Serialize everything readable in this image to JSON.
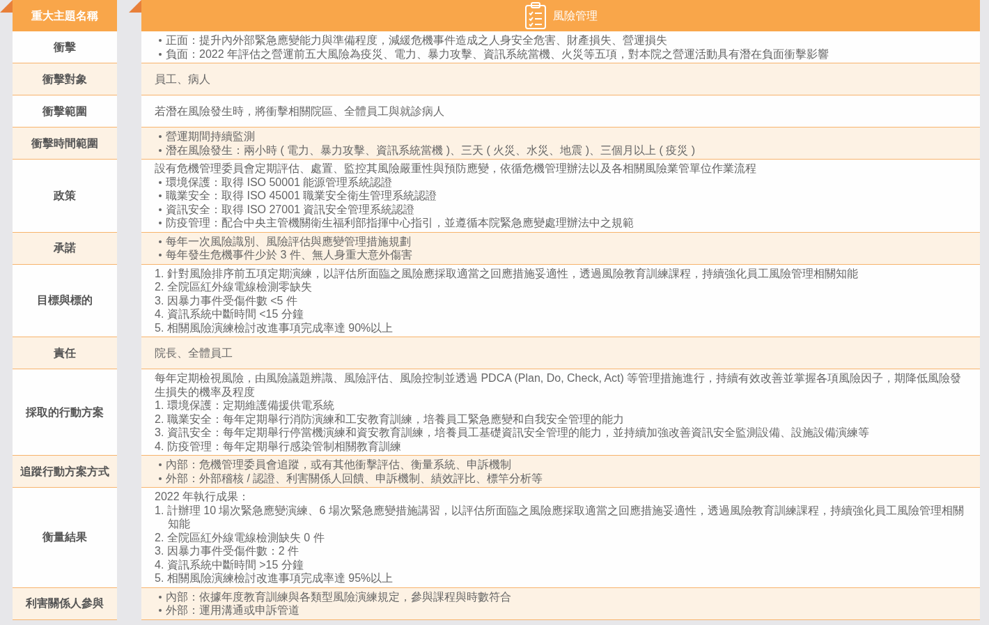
{
  "header": {
    "label_column": "重大主題名稱",
    "topic": "風險管理"
  },
  "rows": [
    {
      "label": "衝擊",
      "lines": [
        {
          "kind": "bullet",
          "text": "正面：提升內外部緊急應變能力與準備程度，減緩危機事件造成之人身安全危害、財產損失、營運損失"
        },
        {
          "kind": "bullet",
          "text": "負面：2022 年評估之營運前五大風險為疫災、電力、暴力攻擊、資訊系統當機、火災等五項，對本院之營運活動具有潛在負面衝擊影響"
        }
      ]
    },
    {
      "label": "衝擊對象",
      "lines": [
        {
          "kind": "plain",
          "text": "員工、病人"
        }
      ]
    },
    {
      "label": "衝擊範圍",
      "lines": [
        {
          "kind": "plain",
          "text": "若潛在風險發生時，將衝擊相關院區、全體員工與就診病人"
        }
      ]
    },
    {
      "label": "衝擊時間範圍",
      "lines": [
        {
          "kind": "bullet",
          "text": "營運期間持續監測"
        },
        {
          "kind": "bullet",
          "text": "潛在風險發生：兩小時 ( 電力、暴力攻擊、資訊系統當機 )、三天 ( 火災、水災、地震 )、三個月以上 ( 疫災 )"
        }
      ]
    },
    {
      "label": "政策",
      "lines": [
        {
          "kind": "plain",
          "text": "設有危機管理委員會定期評估、處置、監控其風險嚴重性與預防應變，依循危機管理辦法以及各相關風險業管單位作業流程"
        },
        {
          "kind": "bullet",
          "text": "環境保護：取得 ISO 50001 能源管理系統認證"
        },
        {
          "kind": "bullet",
          "text": "職業安全：取得 ISO 45001 職業安全衛生管理系統認證"
        },
        {
          "kind": "bullet",
          "text": "資訊安全：取得 ISO 27001 資訊安全管理系統認證"
        },
        {
          "kind": "bullet",
          "text": "防疫管理：配合中央主管機關衛生福利部指揮中心指引，並遵循本院緊急應變處理辦法中之規範"
        }
      ]
    },
    {
      "label": "承諾",
      "lines": [
        {
          "kind": "bullet",
          "text": "每年一次風險識別、風險評估與應變管理措施規劃"
        },
        {
          "kind": "bullet",
          "text": "每年發生危機事件少於 3 件、無人身重大意外傷害"
        }
      ]
    },
    {
      "label": "目標與標的",
      "lines": [
        {
          "kind": "numbered",
          "text": "1. 針對風險排序前五項定期演練，以評估所面臨之風險應採取適當之回應措施妥適性，透過風險教育訓練課程，持續強化員工風險管理相關知能"
        },
        {
          "kind": "numbered",
          "text": "2. 全院區紅外線電線檢測零缺失"
        },
        {
          "kind": "numbered",
          "text": "3. 因暴力事件受傷件數 <5 件"
        },
        {
          "kind": "numbered",
          "text": "4. 資訊系統中斷時間 <15 分鐘"
        },
        {
          "kind": "numbered",
          "text": "5. 相關風險演練檢討改進事項完成率達 90%以上"
        }
      ]
    },
    {
      "label": "責任",
      "lines": [
        {
          "kind": "plain",
          "text": "院長、全體員工"
        }
      ]
    },
    {
      "label": "採取的行動方案",
      "lines": [
        {
          "kind": "plain",
          "text": "每年定期檢視風險，由風險議題辨識、風險評估、風險控制並透過 PDCA (Plan, Do, Check, Act) 等管理措施進行，持續有效改善並掌握各項風險因子，期降低風險發生損失的機率及程度"
        },
        {
          "kind": "numbered",
          "text": "1. 環境保護：定期維護備援供電系統"
        },
        {
          "kind": "numbered",
          "text": "2. 職業安全：每年定期舉行消防演練和工安教育訓練，培養員工緊急應變和自我安全管理的能力"
        },
        {
          "kind": "numbered",
          "text": "3. 資訊安全：每年定期舉行停當機演練和資安教育訓練，培養員工基礎資訊安全管理的能力，並持續加強改善資訊安全監測設備、設施設備演練等"
        },
        {
          "kind": "numbered",
          "text": "4. 防疫管理：每年定期舉行感染管制相關教育訓練"
        }
      ]
    },
    {
      "label": "追蹤行動方案方式",
      "lines": [
        {
          "kind": "bullet",
          "text": "內部：危機管理委員會追蹤，或有其他衝擊評估、衡量系統、申訴機制"
        },
        {
          "kind": "bullet",
          "text": "外部：外部稽核 / 認證、利害關係人回饋、申訴機制、績效評比、標竿分析等"
        }
      ]
    },
    {
      "label": "衡量結果",
      "lines": [
        {
          "kind": "plain",
          "text": "2022 年執行成果："
        },
        {
          "kind": "numbered",
          "text": "1. 計辦理 10 場次緊急應變演練、6 場次緊急應變措施講習，以評估所面臨之風險應採取適當之回應措施妥適性，透過風險教育訓練課程，持續強化員工風險管理相關知能"
        },
        {
          "kind": "numbered",
          "text": "2. 全院區紅外線電線檢測缺失 0 件"
        },
        {
          "kind": "numbered",
          "text": "3. 因暴力事件受傷件數：2 件"
        },
        {
          "kind": "numbered",
          "text": "4. 資訊系統中斷時間 >15 分鐘"
        },
        {
          "kind": "numbered",
          "text": "5. 相關風險演練檢討改進事項完成率達 95%以上"
        }
      ]
    },
    {
      "label": "利害關係人參與",
      "lines": [
        {
          "kind": "bullet",
          "text": "內部：依據年度教育訓練與各類型風險演練規定，參與課程與時數符合"
        },
        {
          "kind": "bullet",
          "text": "外部：運用溝通或申訴管道"
        }
      ]
    }
  ]
}
